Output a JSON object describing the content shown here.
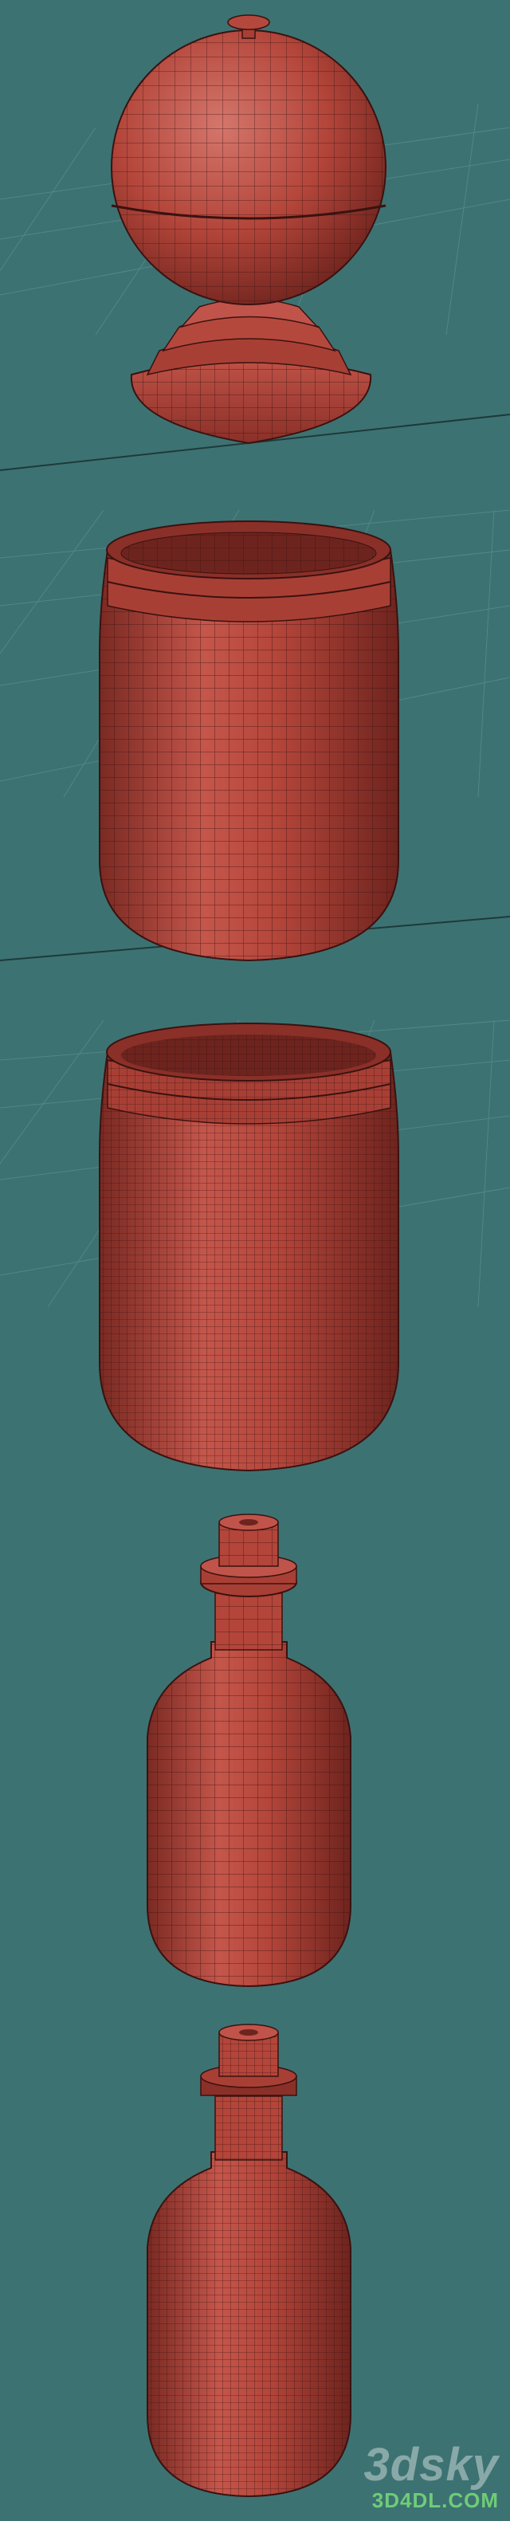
{
  "colors": {
    "background": "#3d7272",
    "grid_line": "#5e8f8f",
    "grid_axis": "#1e3a3a",
    "model_fill": "#b3453a",
    "model_shade": "#7a2a23",
    "model_highlight": "#d8736a",
    "wire": "#3a1210"
  },
  "scene": {
    "views": [
      {
        "object": "sphere-lid",
        "icon": "wireframe-lid"
      },
      {
        "object": "jar-low-poly",
        "icon": "wireframe-jar"
      },
      {
        "object": "jar-high-poly",
        "icon": "wireframe-jar"
      },
      {
        "object": "bottle-low-poly",
        "icon": "wireframe-bottle"
      },
      {
        "object": "bottle-high-poly",
        "icon": "wireframe-bottle"
      }
    ]
  },
  "watermark": {
    "logo": "3dsky",
    "url": "3D4DL.COM"
  }
}
